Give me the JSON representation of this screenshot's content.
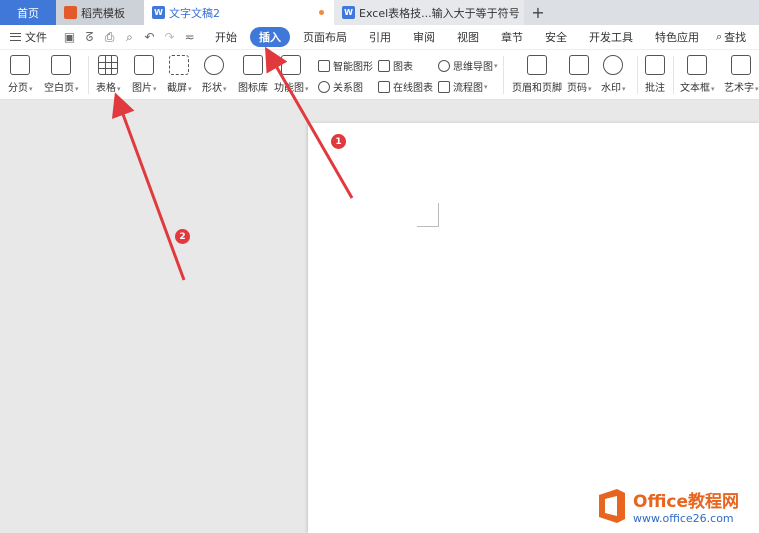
{
  "tabs": [
    {
      "label": "首页"
    },
    {
      "label": "稻壳模板"
    },
    {
      "label": "文字文稿2"
    },
    {
      "label": "Excel表格技...输入大于等于符号"
    }
  ],
  "menu": {
    "file": "文件",
    "items": [
      "开始",
      "插入",
      "页面布局",
      "引用",
      "审阅",
      "视图",
      "章节",
      "安全",
      "开发工具",
      "特色应用"
    ],
    "active": "插入",
    "search": "查找"
  },
  "ribbon": {
    "page_break": "分页",
    "blank_page": "空白页",
    "table": "表格",
    "picture": "图片",
    "screenshot": "截屏",
    "shape": "形状",
    "icon_lib": "图标库",
    "func_chart": "功能图",
    "smart_graphic": "智能图形",
    "chart": "图表",
    "mind_map": "思维导图",
    "relation_chart": "关系图",
    "online_chart": "在线图表",
    "flow_chart": "流程图",
    "header_footer": "页眉和页脚",
    "page_number": "页码",
    "watermark": "水印",
    "comment": "批注",
    "text_box": "文本框",
    "art_text": "艺术字"
  },
  "annotations": {
    "step1": "1",
    "step2": "2"
  },
  "watermark": {
    "title": "Office教程网",
    "url": "www.office26.com"
  },
  "colors": {
    "accent": "#3f78d8",
    "arrow": "#e03a3e",
    "brand_orange": "#e7651f"
  }
}
